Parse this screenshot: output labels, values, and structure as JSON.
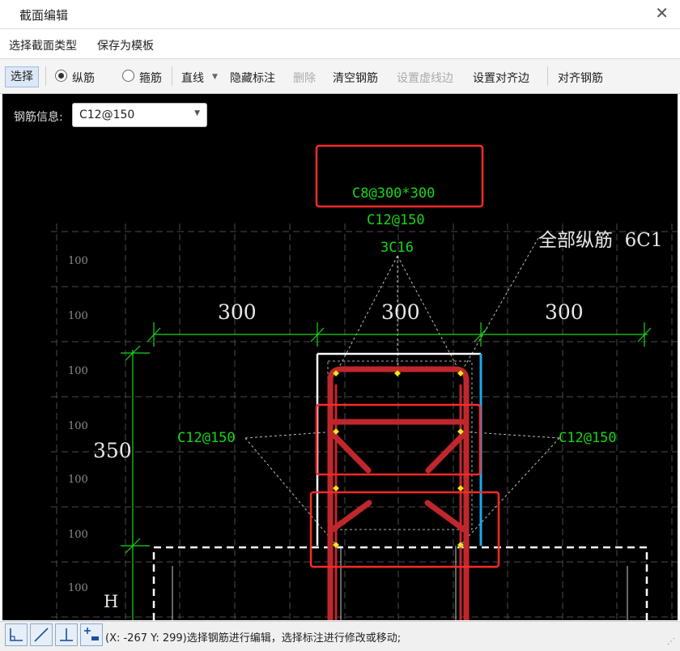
{
  "window": {
    "title": "截面编辑"
  },
  "menu": {
    "items": [
      "选择截面类型",
      "保存为模板"
    ]
  },
  "toolbar": {
    "select": "选择",
    "radio_longitudinal": "纵筋",
    "radio_stirrup": "箍筋",
    "line": "直线",
    "hide_annotation": "隐藏标注",
    "delete": "删除",
    "clear_rebar": "清空钢筋",
    "set_dashed_edge": "设置虚线边",
    "set_align_edge": "设置对齐边",
    "align_rebar": "对齐钢筋"
  },
  "rebar_info": {
    "label": "钢筋信息:",
    "value": "C12@150"
  },
  "drawing": {
    "grid_labels": [
      "100",
      "100",
      "100",
      "100",
      "100",
      "100",
      "100"
    ],
    "dims_top": [
      "300",
      "300",
      "300"
    ],
    "dim_left": "350",
    "label_h": "H",
    "annot_top_stirrup": "C8@300*300",
    "annot_top_c12": "C12@150",
    "annot_3c16": "3C16",
    "annot_all_long": "全部纵筋  6C1",
    "annot_left": "C12@150",
    "annot_right": "C12@150"
  },
  "colors": {
    "green": "#19d619",
    "red": "#c0272d",
    "highlight": "#ff2a2a",
    "blue": "#1ea7e8",
    "grid": "#4a4a4a"
  },
  "status": {
    "text": "(X: -267 Y: 299)选择钢筋进行编辑，选择标注进行修改或移动;"
  }
}
